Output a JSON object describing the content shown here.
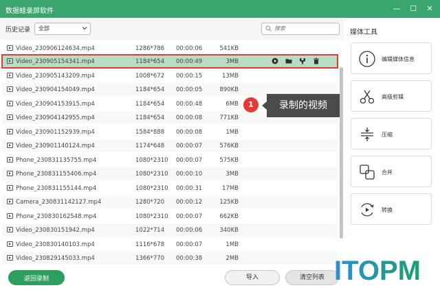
{
  "window": {
    "title": "数据蛙录屏软件",
    "minimize": "—",
    "maximize": "☐",
    "close": "✕"
  },
  "history": {
    "label": "历史记录",
    "filter_value": "全部"
  },
  "search": {
    "placeholder": "搜索"
  },
  "files": [
    {
      "name": "Video_230906124634.mp4",
      "resolution": "1286*786",
      "duration": "00:00:06",
      "size": "541KB"
    },
    {
      "name": "Video_230905154341.mp4",
      "resolution": "1184*654",
      "duration": "00:00:49",
      "size": "3MB",
      "selected": true
    },
    {
      "name": "Video_230905143209.mp4",
      "resolution": "1008*672",
      "duration": "00:00:15",
      "size": "13MB"
    },
    {
      "name": "Video_230904154049.mp4",
      "resolution": "1184*654",
      "duration": "00:00:05",
      "size": "890KB"
    },
    {
      "name": "Video_230904153915.mp4",
      "resolution": "1184*654",
      "duration": "00:00:48",
      "size": "6MB"
    },
    {
      "name": "Video_230904142955.mp4",
      "resolution": "1184*654",
      "duration": "00:00:08",
      "size": "771KB"
    },
    {
      "name": "Video_230901152939.mp4",
      "resolution": "1584*888",
      "duration": "00:00:08",
      "size": "1MB"
    },
    {
      "name": "Video_230901140124.mp4",
      "resolution": "1174*648",
      "duration": "00:00:07",
      "size": "576KB"
    },
    {
      "name": "Phone_230831135755.mp4",
      "resolution": "1080*2310",
      "duration": "00:00:07",
      "size": "575KB"
    },
    {
      "name": "Phone_230831155406.mp4",
      "resolution": "1080*2310",
      "duration": "00:00:10",
      "size": "3MB"
    },
    {
      "name": "Phone_230831155144.mp4",
      "resolution": "1080*2310",
      "duration": "00:00:31",
      "size": "17MB"
    },
    {
      "name": "Camera_230831142127.mp4",
      "resolution": "1280*720",
      "duration": "00:00:12",
      "size": "125KB"
    },
    {
      "name": "Phone_230830162548.mp4",
      "resolution": "1080*2310",
      "duration": "00:00:07",
      "size": "662KB"
    },
    {
      "name": "Video_230830151942.mp4",
      "resolution": "1022*714",
      "duration": "00:00:06",
      "size": "340KB"
    },
    {
      "name": "Video_230830140103.mp4",
      "resolution": "1116*678",
      "duration": "00:00:07",
      "size": "1MB"
    },
    {
      "name": "Video_230829145033.mp4",
      "resolution": "1366*770",
      "duration": "00:00:38",
      "size": "2MB"
    }
  ],
  "row_actions": [
    "play-icon",
    "folder-icon",
    "edit-icon",
    "delete-icon"
  ],
  "callout": {
    "number": "1",
    "text": "录制的视频"
  },
  "sidebar": {
    "title": "媒体工具",
    "tools": [
      {
        "label": "编辑媒体信息",
        "icon": "info-icon"
      },
      {
        "label": "高级剪辑",
        "icon": "scissors-icon"
      },
      {
        "label": "压缩",
        "icon": "compress-icon"
      },
      {
        "label": "合并",
        "icon": "merge-icon"
      },
      {
        "label": "转换",
        "icon": "convert-icon"
      }
    ]
  },
  "footer": {
    "back": "返回录制",
    "import": "导入",
    "clear": "清空列表"
  },
  "watermark": {
    "text": "ITOPM"
  },
  "colors": {
    "accent": "#3aa66e",
    "selected_row": "#b9dcc5",
    "highlight_border": "#e53935",
    "callout_bg": "#4b4b4b"
  }
}
